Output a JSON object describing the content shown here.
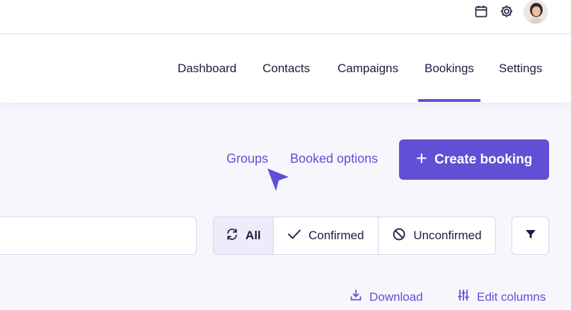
{
  "topbar": {
    "icons": [
      "calendar-icon",
      "gear-icon"
    ],
    "avatar": "user-avatar"
  },
  "nav": {
    "items": [
      {
        "label": "Dashboard"
      },
      {
        "label": "Contacts"
      },
      {
        "label": "Campaigns"
      },
      {
        "label": "Bookings",
        "active": true
      },
      {
        "label": "Settings"
      }
    ]
  },
  "actions": {
    "groups_label": "Groups",
    "booked_options_label": "Booked options",
    "create_booking_label": "Create booking"
  },
  "search": {
    "value": "",
    "placeholder": ""
  },
  "filter_tabs": [
    {
      "label": "All",
      "icon": "refresh-icon",
      "active": true
    },
    {
      "label": "Confirmed",
      "icon": "check-icon"
    },
    {
      "label": "Unconfirmed",
      "icon": "ban-icon"
    }
  ],
  "toolbar": {
    "download_label": "Download",
    "edit_columns_label": "Edit columns",
    "filter_icon": "funnel-icon"
  },
  "colors": {
    "accent": "#5f50d6",
    "text": "#1f1b3d",
    "border": "#d8d4ec",
    "background": "#f7f6fc"
  }
}
